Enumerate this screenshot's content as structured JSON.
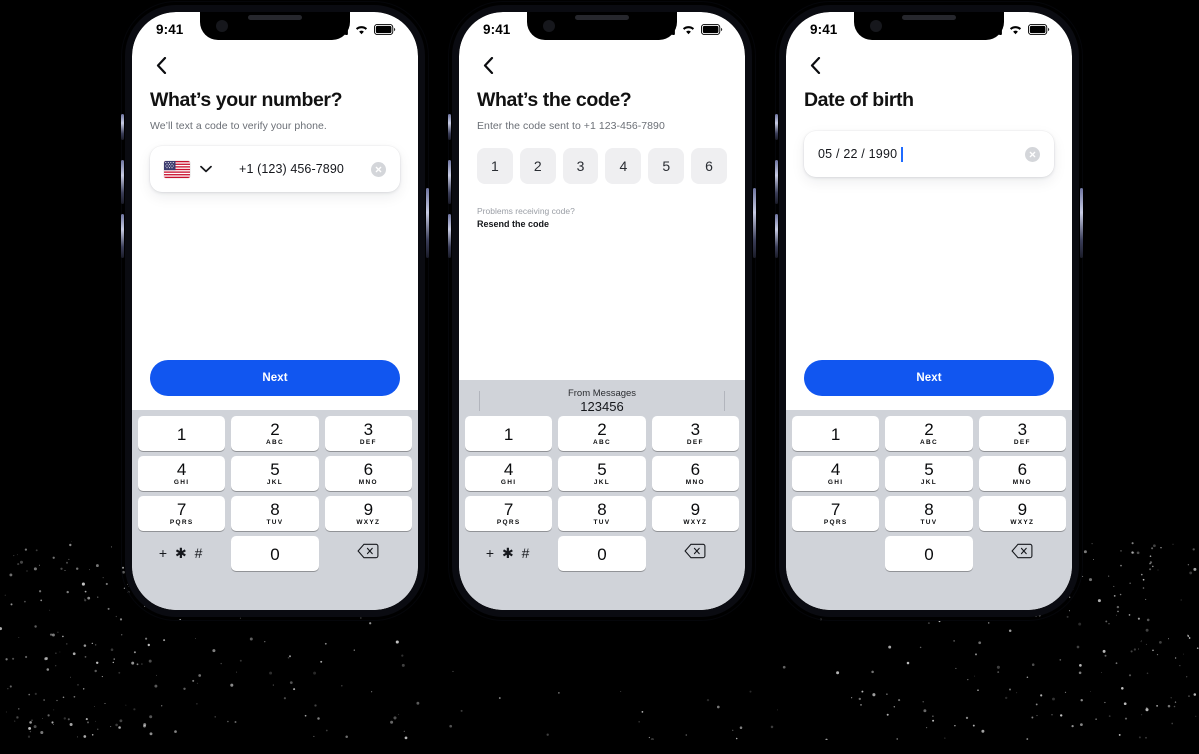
{
  "colors": {
    "accent": "#1156f0",
    "keyboard_bg": "#d0d3d9",
    "key_bg": "#ffffff",
    "otp_bg": "#efeff1",
    "muted_text": "#6b6f76",
    "page_bg": "#000000"
  },
  "status_bar": {
    "time": "9:41",
    "icons": [
      "cellular-signal-icon",
      "wifi-icon",
      "battery-icon"
    ]
  },
  "keypad": {
    "keys": [
      {
        "num": "1",
        "letters": ""
      },
      {
        "num": "2",
        "letters": "ABC"
      },
      {
        "num": "3",
        "letters": "DEF"
      },
      {
        "num": "4",
        "letters": "GHI"
      },
      {
        "num": "5",
        "letters": "JKL"
      },
      {
        "num": "6",
        "letters": "MNO"
      },
      {
        "num": "7",
        "letters": "PQRS"
      },
      {
        "num": "8",
        "letters": "TUV"
      },
      {
        "num": "9",
        "letters": "WXYZ"
      },
      {
        "num": "0",
        "letters": ""
      }
    ],
    "symbol_key": "+ ✱ #",
    "delete_key": "delete-key"
  },
  "phones": [
    {
      "id": "phone-number-entry",
      "back_label": "‹",
      "title": "What’s your number?",
      "subtitle": "We’ll text a code to verify your phone.",
      "input": {
        "country_flag": "us-flag-icon",
        "country_chevron": "chevron-down-icon",
        "value": "+1 (123) 456-7890",
        "clear": "clear-icon"
      },
      "primary_button": "Next",
      "keyboard": {
        "suggestion_bar": false,
        "symbol_key": true
      }
    },
    {
      "id": "verification-code-entry",
      "back_label": "‹",
      "title": "What’s the code?",
      "subtitle": "Enter the code sent to +1 123-456-7890",
      "otp_digits": [
        "1",
        "2",
        "3",
        "4",
        "5",
        "6"
      ],
      "problem_text": "Problems receiving code?",
      "resend_text": "Resend the code",
      "keyboard": {
        "suggestion_bar": true,
        "suggestion_source": "From Messages",
        "suggestion_value": "123456",
        "symbol_key": true
      }
    },
    {
      "id": "date-of-birth-entry",
      "back_label": "‹",
      "title": "Date of birth",
      "input": {
        "value": "05 / 22 / 1990",
        "clear": "clear-icon",
        "caret": true
      },
      "primary_button": "Next",
      "keyboard": {
        "suggestion_bar": false,
        "symbol_key": false
      }
    }
  ]
}
